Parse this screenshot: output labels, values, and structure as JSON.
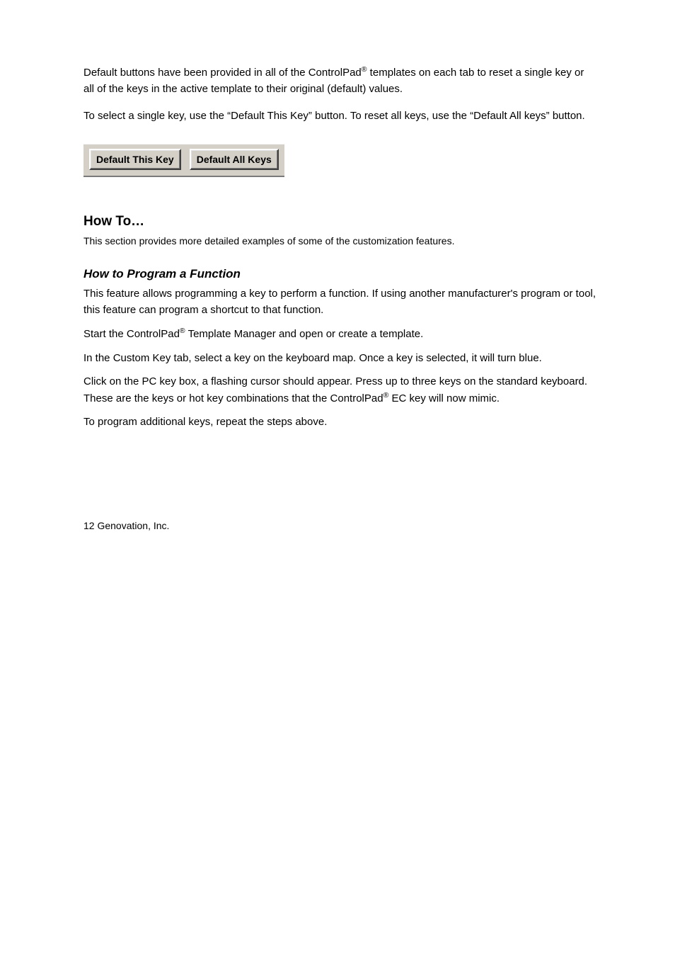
{
  "intro": {
    "para1_pre": "Default buttons have been provided in all of the ControlPad",
    "reg1": "®",
    "para1_post": " templates on each tab to reset a single key or all of the keys in the active template to their original (default) values.",
    "para2": "To select a single key, use the “Default This Key” button. To reset all keys, use the “Default All keys” button."
  },
  "buttons": {
    "default_this_key": "Default This Key",
    "default_all_keys": "Default All Keys"
  },
  "section": {
    "title": "How To…",
    "subtitle": "This section provides more detailed examples of some of the customization features."
  },
  "howto1": {
    "title": "How to Program a Function",
    "p1": "This feature allows programming a key to perform a function. If using another manufacturer's program or tool, this feature can program a shortcut to that function.",
    "p2_pre": "Start the ControlPad",
    "p2_reg": "®",
    "p2_post": " Template Manager and open or create a template.",
    "p3": "In the Custom Key tab, select a key on the keyboard map.  Once a key is selected, it will turn blue.",
    "p4_pre": "Click on the PC key box, a flashing cursor should appear.  Press up to three keys on the standard keyboard.  These are the keys or hot key combinations that the ControlPad",
    "p4_reg": "®",
    "p4_post": " EC key will now mimic.",
    "p5": "To program additional keys, repeat the steps above."
  },
  "footer": "12                                                                                                                                 Genovation, Inc."
}
